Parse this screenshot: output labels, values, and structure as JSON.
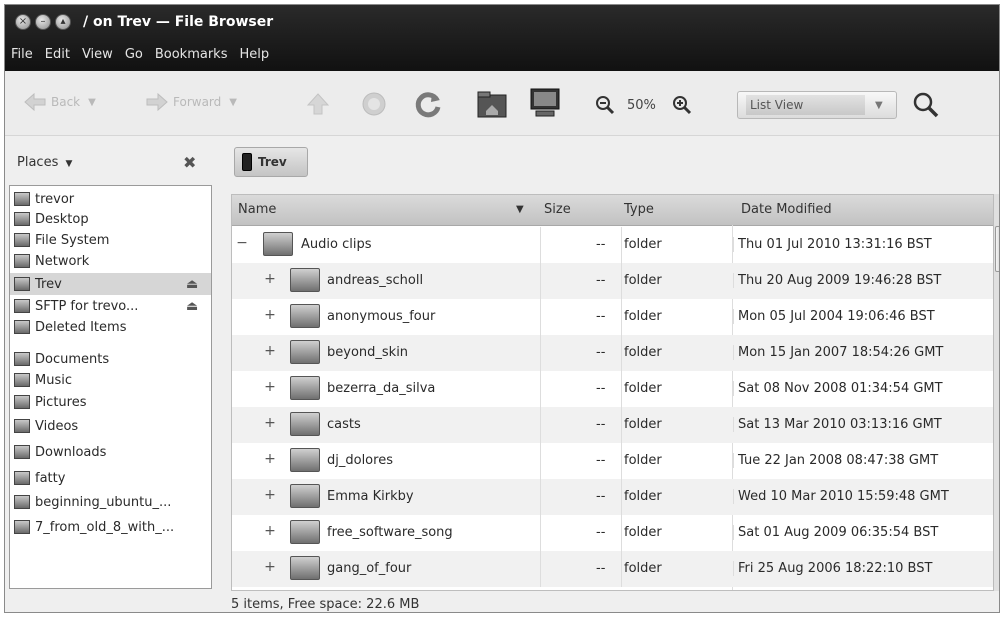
{
  "window": {
    "title": "/ on Trev — File Browser"
  },
  "menubar": [
    "File",
    "Edit",
    "View",
    "Go",
    "Bookmarks",
    "Help"
  ],
  "toolbar": {
    "back_label": "Back",
    "forward_label": "Forward",
    "zoom_level": "50%",
    "view_mode": "List View",
    "icons": [
      "up-icon",
      "stop-icon",
      "reload-icon",
      "home-icon",
      "computer-icon",
      "zoom-out-icon",
      "zoom-in-icon",
      "search-icon"
    ]
  },
  "sidebar": {
    "header": "Places",
    "items": [
      {
        "label": "trevor",
        "icon": "home-folder-icon"
      },
      {
        "label": "Desktop",
        "icon": "desktop-icon"
      },
      {
        "label": "File System",
        "icon": "drive-icon"
      },
      {
        "label": "Network",
        "icon": "network-icon"
      },
      {
        "label": "Trev",
        "icon": "phone-icon",
        "selected": true,
        "eject": true
      },
      {
        "label": "SFTP for trevo...",
        "icon": "network-share-icon",
        "eject": true
      },
      {
        "label": "Deleted Items",
        "icon": "trash-icon"
      },
      {
        "label": "Documents",
        "icon": "documents-folder-icon"
      },
      {
        "label": "Music",
        "icon": "music-folder-icon"
      },
      {
        "label": "Pictures",
        "icon": "pictures-folder-icon"
      },
      {
        "label": "Videos",
        "icon": "videos-folder-icon"
      },
      {
        "label": "Downloads",
        "icon": "downloads-folder-icon"
      },
      {
        "label": "fatty",
        "icon": "folder-icon"
      },
      {
        "label": "beginning_ubuntu_...",
        "icon": "folder-icon"
      },
      {
        "label": "7_from_old_8_with_...",
        "icon": "folder-icon"
      }
    ]
  },
  "pathbar": {
    "current": "Trev"
  },
  "filelist": {
    "columns": {
      "name": "Name",
      "size": "Size",
      "type": "Type",
      "date": "Date Modified"
    },
    "rows": [
      {
        "expander": "−",
        "name": "Audio clips",
        "size": "--",
        "type": "folder",
        "date": "Thu 01 Jul 2010 13:31:16 BST",
        "level": 0
      },
      {
        "expander": "+",
        "name": "andreas_scholl",
        "size": "--",
        "type": "folder",
        "date": "Thu 20 Aug 2009 19:46:28 BST",
        "level": 1
      },
      {
        "expander": "+",
        "name": "anonymous_four",
        "size": "--",
        "type": "folder",
        "date": "Mon 05 Jul 2004 19:06:46 BST",
        "level": 1
      },
      {
        "expander": "+",
        "name": "beyond_skin",
        "size": "--",
        "type": "folder",
        "date": "Mon 15 Jan 2007 18:54:26 GMT",
        "level": 1
      },
      {
        "expander": "+",
        "name": "bezerra_da_silva",
        "size": "--",
        "type": "folder",
        "date": "Sat 08 Nov 2008 01:34:54 GMT",
        "level": 1
      },
      {
        "expander": "+",
        "name": "casts",
        "size": "--",
        "type": "folder",
        "date": "Sat 13 Mar 2010 03:13:16 GMT",
        "level": 1
      },
      {
        "expander": "+",
        "name": "dj_dolores",
        "size": "--",
        "type": "folder",
        "date": "Tue 22 Jan 2008 08:47:38 GMT",
        "level": 1
      },
      {
        "expander": "+",
        "name": "Emma Kirkby",
        "size": "--",
        "type": "folder",
        "date": "Wed 10 Mar 2010 15:59:48 GMT",
        "level": 1
      },
      {
        "expander": "+",
        "name": "free_software_song",
        "size": "--",
        "type": "folder",
        "date": "Sat 01 Aug 2009 06:35:54 BST",
        "level": 1
      },
      {
        "expander": "+",
        "name": "gang_of_four",
        "size": "--",
        "type": "folder",
        "date": "Fri 25 Aug 2006 18:22:10 BST",
        "level": 1
      }
    ]
  },
  "status": "5 items, Free space: 22.6 MB"
}
